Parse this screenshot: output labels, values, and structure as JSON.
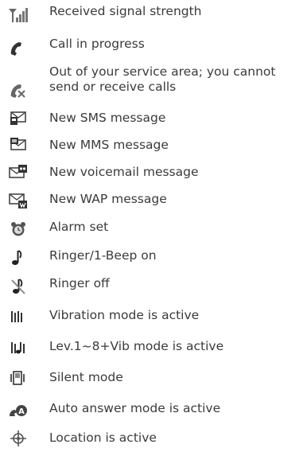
{
  "legend": {
    "items": [
      {
        "icon": "signal-strength-icon",
        "label": "Received signal strength"
      },
      {
        "icon": "call-in-progress-icon",
        "label": "Call in progress"
      },
      {
        "icon": "no-service-icon",
        "label": "Out of your service area; you cannot",
        "label2": "send or receive calls"
      },
      {
        "icon": "sms-message-icon",
        "label": "New SMS message"
      },
      {
        "icon": "mms-message-icon",
        "label": "New MMS message"
      },
      {
        "icon": "voicemail-icon",
        "label": "New voicemail message"
      },
      {
        "icon": "wap-message-icon",
        "label": "New WAP message"
      },
      {
        "icon": "alarm-clock-icon",
        "label": "Alarm set"
      },
      {
        "icon": "ringer-note-icon",
        "label": "Ringer/1-Beep on"
      },
      {
        "icon": "ringer-off-icon",
        "label": "Ringer off"
      },
      {
        "icon": "vibration-icon",
        "label": "Vibration mode is active"
      },
      {
        "icon": "ringer-vibration-icon",
        "label": "Lev.1~8+Vib mode is active"
      },
      {
        "icon": "silent-mode-icon",
        "label": "Silent mode"
      },
      {
        "icon": "auto-answer-icon",
        "label": "Auto answer mode is active"
      },
      {
        "icon": "location-icon",
        "label": "Location is active"
      }
    ]
  }
}
